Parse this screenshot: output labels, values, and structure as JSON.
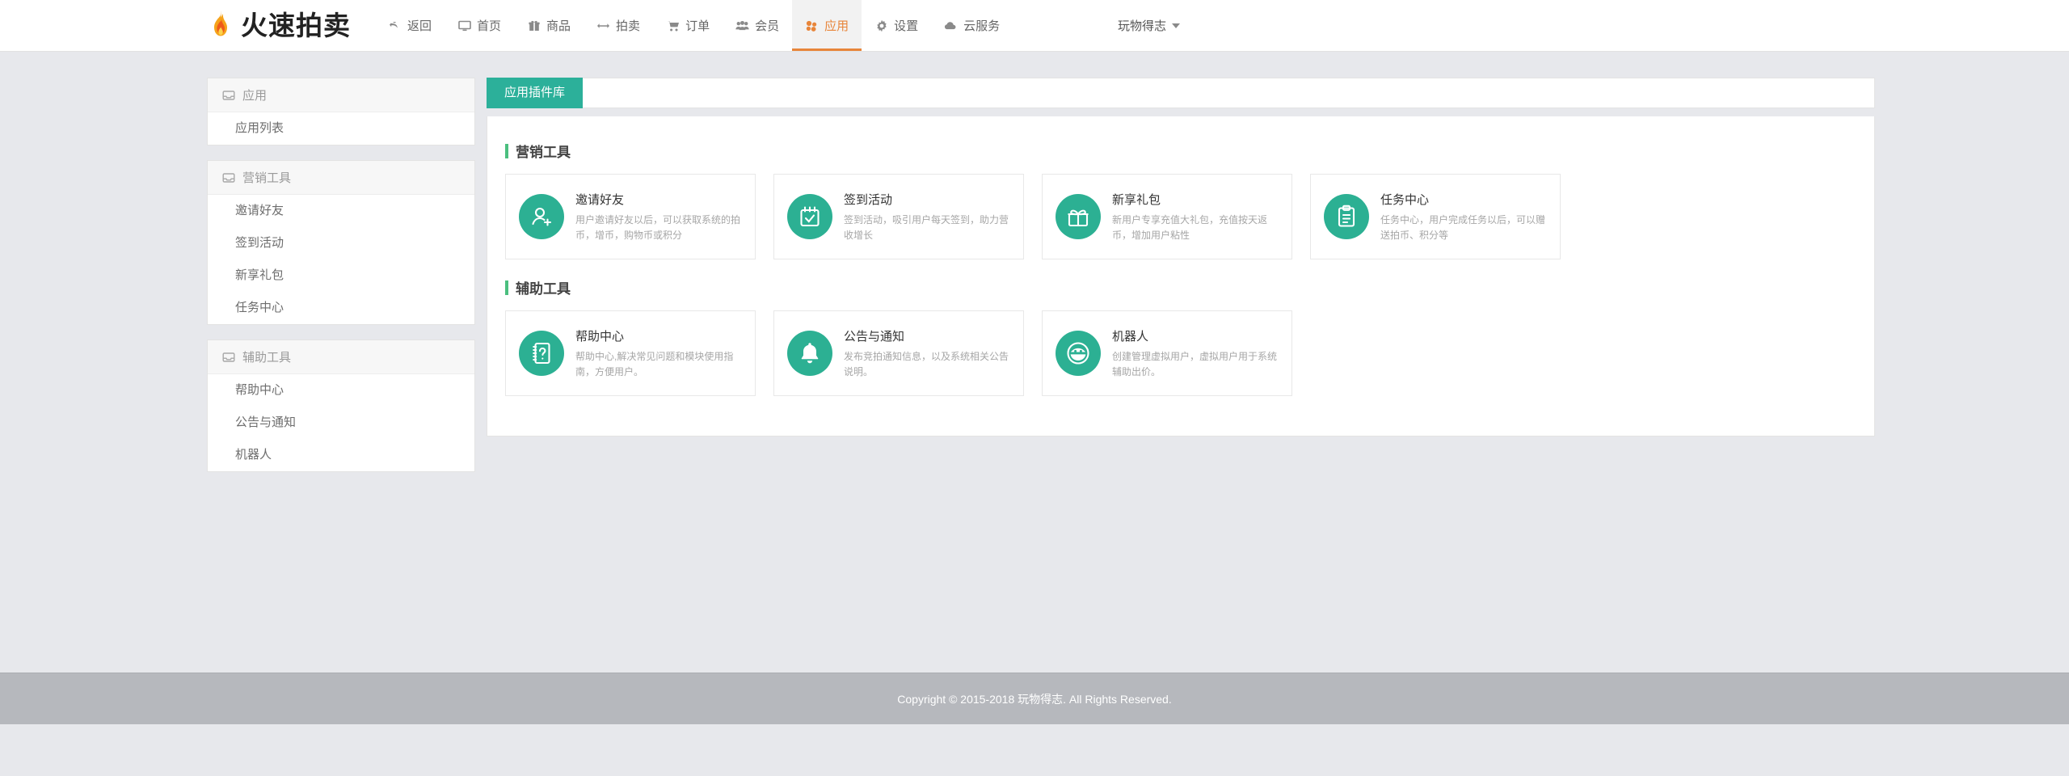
{
  "brand": {
    "name": "火速拍卖",
    "logo_icon": "flame-icon"
  },
  "navbar": {
    "items": [
      {
        "label": "返回",
        "icon": "undo-arrow-icon",
        "active": false
      },
      {
        "label": "首页",
        "icon": "desktop-monitor-icon",
        "active": false
      },
      {
        "label": "商品",
        "icon": "gift-box-icon",
        "active": false
      },
      {
        "label": "拍卖",
        "icon": "arrows-horizontal-icon",
        "active": false
      },
      {
        "label": "订单",
        "icon": "shopping-cart-icon",
        "active": false
      },
      {
        "label": "会员",
        "icon": "users-group-icon",
        "active": false
      },
      {
        "label": "应用",
        "icon": "cubes-icon",
        "active": true
      },
      {
        "label": "设置",
        "icon": "gear-icon",
        "active": false
      },
      {
        "label": "云服务",
        "icon": "cloud-icon",
        "active": false
      }
    ],
    "user": {
      "name": "玩物得志",
      "caret_icon": "chevron-down-icon"
    },
    "active_color": "#e8853a"
  },
  "sidebar": {
    "groups": [
      {
        "title": "应用",
        "icon": "inbox-tray-icon",
        "links": [
          {
            "label": "应用列表"
          }
        ]
      },
      {
        "title": "营销工具",
        "icon": "inbox-tray-icon",
        "links": [
          {
            "label": "邀请好友"
          },
          {
            "label": "签到活动"
          },
          {
            "label": "新享礼包"
          },
          {
            "label": "任务中心"
          }
        ]
      },
      {
        "title": "辅助工具",
        "icon": "inbox-tray-icon",
        "links": [
          {
            "label": "帮助中心"
          },
          {
            "label": "公告与通知"
          },
          {
            "label": "机器人"
          }
        ]
      }
    ]
  },
  "content": {
    "tab": {
      "label": "应用插件库",
      "active": true,
      "color": "#2cb09a"
    },
    "sections": [
      {
        "title": "营销工具",
        "accent": "#4bbf7f",
        "cards": [
          {
            "title": "邀请好友",
            "desc": "用户邀请好友以后，可以获取系统的拍币，增币，购物币或积分",
            "icon": "user-plus-icon"
          },
          {
            "title": "签到活动",
            "desc": "签到活动，吸引用户每天签到，助力营收增长",
            "icon": "calendar-check-icon"
          },
          {
            "title": "新享礼包",
            "desc": "新用户专享充值大礼包，充值按天返币，增加用户粘性",
            "icon": "gift-icon"
          },
          {
            "title": "任务中心",
            "desc": "任务中心，用户完成任务以后，可以赠送拍币、积分等",
            "icon": "clipboard-list-icon"
          }
        ]
      },
      {
        "title": "辅助工具",
        "accent": "#4bbf7f",
        "cards": [
          {
            "title": "帮助中心",
            "desc": "帮助中心,解决常见问题和模块使用指南，方便用户。",
            "icon": "question-book-icon"
          },
          {
            "title": "公告与通知",
            "desc": "发布竞拍通知信息，以及系统相关公告说明。",
            "icon": "bell-icon"
          },
          {
            "title": "机器人",
            "desc": "创建管理虚拟用户，虚拟用户用于系统辅助出价。",
            "icon": "robot-face-icon"
          }
        ]
      }
    ],
    "card_icon_color": "#2cb093"
  },
  "footer": {
    "copyright": "Copyright © 2015-2018 玩物得志. All Rights Reserved."
  }
}
